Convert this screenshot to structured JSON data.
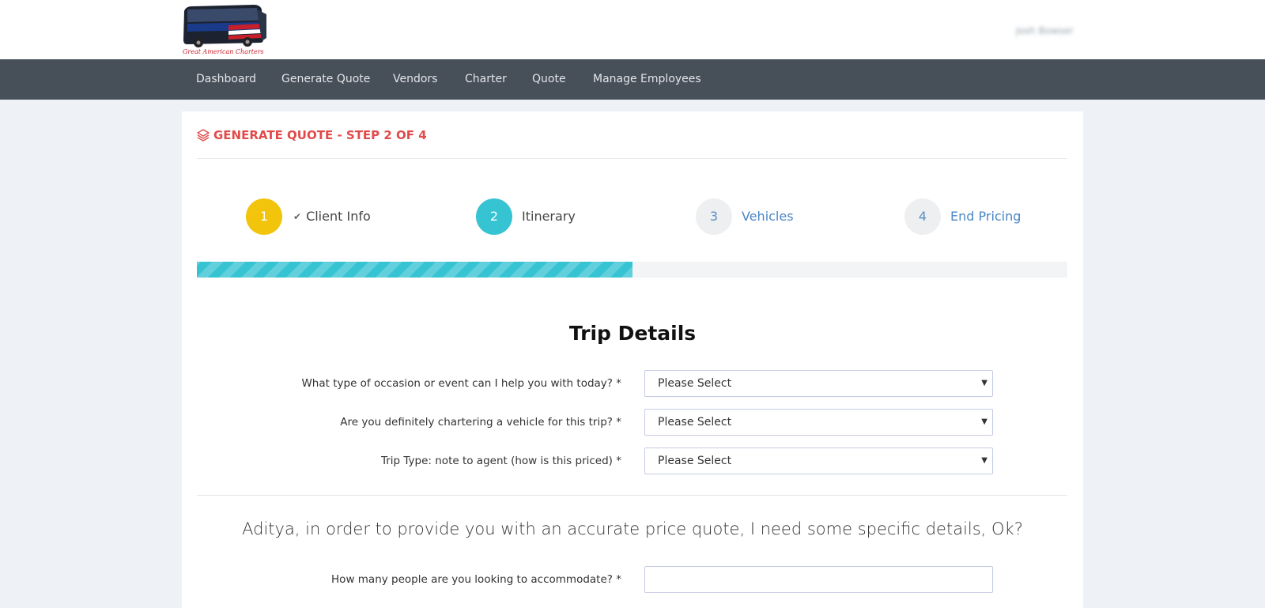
{
  "header": {
    "logo_text": "Great American Charters",
    "user_name": "Josh Bowser"
  },
  "nav": {
    "items": [
      "Dashboard",
      "Generate Quote",
      "Vendors",
      "Charter",
      "Quote",
      "Manage Employees"
    ]
  },
  "page": {
    "title": "GENERATE QUOTE - STEP 2 OF 4",
    "title_icon": "layers-icon"
  },
  "steps": [
    {
      "number": "1",
      "label": "Client Info",
      "completed": true,
      "status_icon": "check-icon"
    },
    {
      "number": "2",
      "label": "Itinerary",
      "active": true
    },
    {
      "number": "3",
      "label": "Vehicles"
    },
    {
      "number": "4",
      "label": "End Pricing"
    }
  ],
  "progress": {
    "percent": 50
  },
  "trip_details": {
    "heading": "Trip Details",
    "fields": [
      {
        "label": "What type of occasion or event can I help you with today? *",
        "value": "Please Select"
      },
      {
        "label": "Are you definitely chartering a vehicle for this trip? *",
        "value": "Please Select"
      },
      {
        "label": "Trip Type: note to agent (how is this priced) *",
        "value": "Please Select"
      }
    ]
  },
  "details_prompt": "Aditya, in order to provide you with an accurate price quote, I need some specific details, Ok?",
  "passengers_field": {
    "label": "How many people are you looking to accommodate? *",
    "value": ""
  },
  "colors": {
    "accent_red": "#e24a4a",
    "step_yellow": "#f2c40c",
    "step_cyan": "#36c3d2",
    "nav_bg": "#474f59"
  }
}
